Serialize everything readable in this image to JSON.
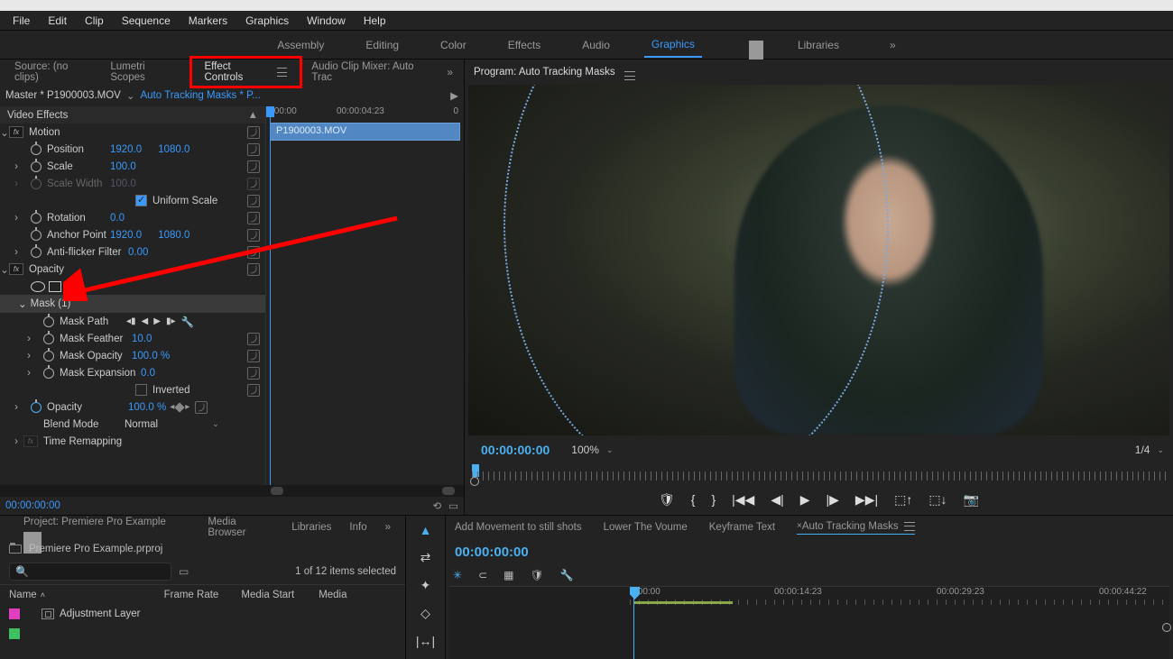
{
  "menu": [
    "File",
    "Edit",
    "Clip",
    "Sequence",
    "Markers",
    "Graphics",
    "Window",
    "Help"
  ],
  "workspaces": {
    "items": [
      "Assembly",
      "Editing",
      "Color",
      "Effects",
      "Audio",
      "Graphics",
      "Libraries"
    ],
    "active": "Graphics"
  },
  "source_tabs": {
    "source": "Source: (no clips)",
    "lumetri": "Lumetri Scopes",
    "effect_controls": "Effect Controls",
    "audio_mixer": "Audio Clip Mixer: Auto Trac"
  },
  "master": {
    "clip": "Master * P1900003.MOV",
    "sequence": "Auto Tracking Masks * P..."
  },
  "effects": {
    "header": "Video Effects",
    "motion": {
      "label": "Motion",
      "position": {
        "label": "Position",
        "x": "1920.0",
        "y": "1080.0"
      },
      "scale": {
        "label": "Scale",
        "value": "100.0"
      },
      "scale_width": {
        "label": "Scale Width",
        "value": "100.0"
      },
      "uniform": {
        "label": "Uniform Scale"
      },
      "rotation": {
        "label": "Rotation",
        "value": "0.0"
      },
      "anchor": {
        "label": "Anchor Point",
        "x": "1920.0",
        "y": "1080.0"
      },
      "antiflicker": {
        "label": "Anti-flicker Filter",
        "value": "0.00"
      }
    },
    "opacity": {
      "label": "Opacity",
      "mask_label": "Mask (1)",
      "mask_path": "Mask Path",
      "mask_feather": {
        "label": "Mask Feather",
        "value": "10.0"
      },
      "mask_opacity": {
        "label": "Mask Opacity",
        "value": "100.0 %"
      },
      "mask_expansion": {
        "label": "Mask Expansion",
        "value": "0.0"
      },
      "inverted": "Inverted",
      "opacity_prop": {
        "label": "Opacity",
        "value": "100.0 %"
      },
      "blend": {
        "label": "Blend Mode",
        "value": "Normal"
      }
    },
    "time_remap": "Time Remapping"
  },
  "effect_timeline": {
    "start": ":00:00",
    "duration": "00:00:04:23",
    "end_tick": "0",
    "clip": "P1900003.MOV"
  },
  "effect_current_tc": "00:00:00:00",
  "program": {
    "label": "Program: Auto Tracking Masks",
    "timecode": "00:00:00:00",
    "zoom": "100%",
    "resolution": "1/4"
  },
  "project": {
    "tabs": {
      "project": "Project: Premiere Pro Example",
      "media_browser": "Media Browser",
      "libraries": "Libraries",
      "info": "Info"
    },
    "file": "Premiere Pro Example.prproj",
    "selection": "1 of 12 items selected",
    "headers": {
      "name": "Name",
      "frame_rate": "Frame Rate",
      "media_start": "Media Start",
      "media": "Media"
    },
    "row1": "Adjustment Layer"
  },
  "timeline": {
    "tabs": {
      "t1": "Add Movement to still shots",
      "t2": "Lower The Voume",
      "t3": "Keyframe Text",
      "t4": "Auto Tracking Masks"
    },
    "timecode": "00:00:00:00",
    "ruler": {
      "r0": ":00:00",
      "r1": "00:00:14:23",
      "r2": "00:00:29:23",
      "r3": "00:00:44:22"
    }
  }
}
